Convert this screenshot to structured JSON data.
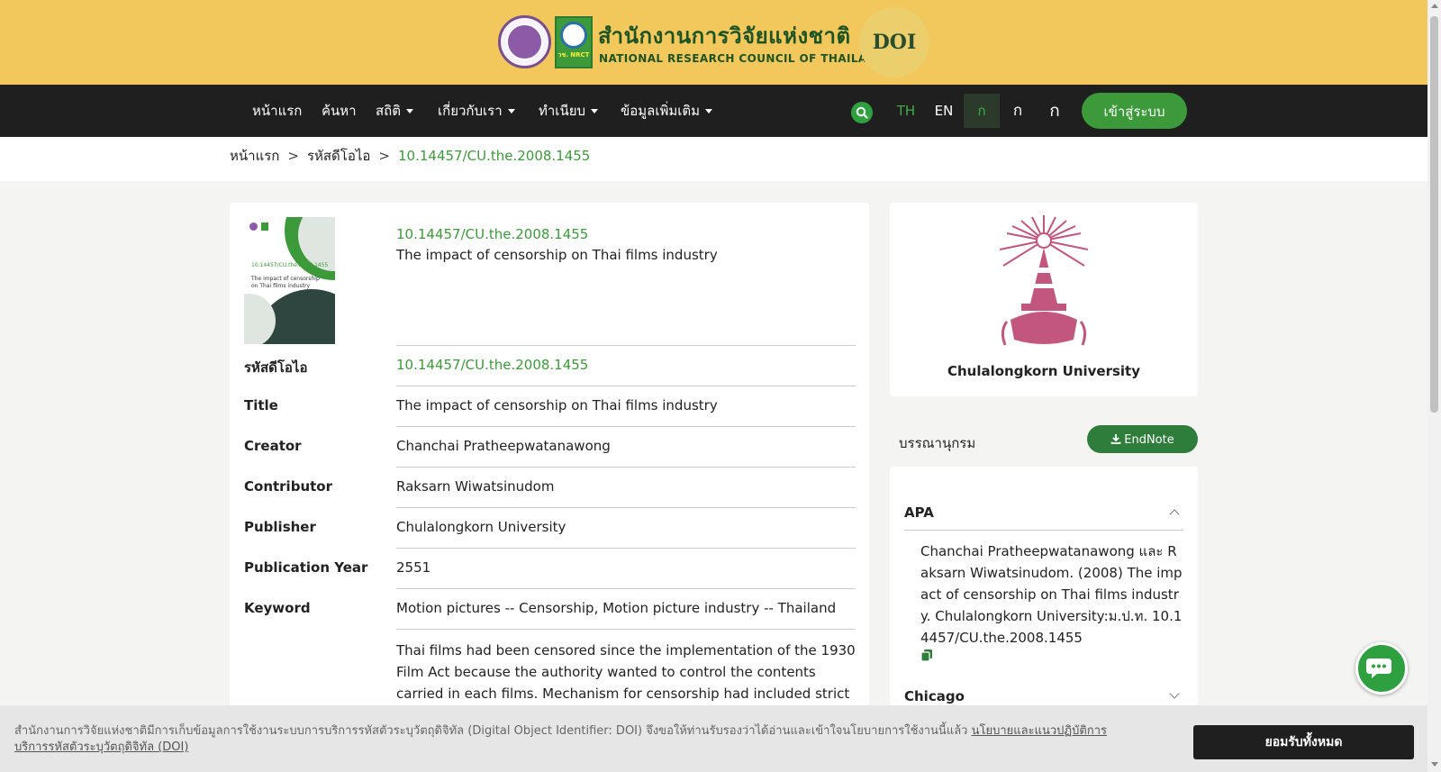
{
  "header": {
    "org_name_th": "สำนักงานการวิจัยแห่งชาติ",
    "org_name_en": "NATIONAL RESEARCH COUNCIL OF THAILAND",
    "nrct_logo_text": "วช. NRCT",
    "doi_logo_text": "DOI"
  },
  "nav": {
    "items": [
      {
        "label": "หน้าแรก"
      },
      {
        "label": "ค้นหา"
      },
      {
        "label": "สถิติ"
      },
      {
        "label": "เกี่ยวกับเรา"
      },
      {
        "label": "ทำเนียบ"
      },
      {
        "label": "ข้อมูลเพิ่มเติม"
      }
    ],
    "lang_th": "TH",
    "lang_en": "EN",
    "font_small": "ก",
    "font_medium": "ก",
    "font_large": "ก",
    "login_label": "เข้าสู่ระบบ"
  },
  "breadcrumb": {
    "home": "หน้าแรก",
    "section": "รหัสดีโอไอ",
    "current": "10.14457/CU.the.2008.1455",
    "separator": ">"
  },
  "record": {
    "cover_doi": "10.14457/CU.the.2008.1455",
    "cover_title": "The impact of censorship on Thai films industry",
    "head_doi": "10.14457/CU.the.2008.1455",
    "head_title": "The impact of censorship on Thai films industry",
    "fields": [
      {
        "label": "รหัสดีโอไอ",
        "value": "10.14457/CU.the.2008.1455"
      },
      {
        "label": "Title",
        "value": "The impact of censorship on Thai films industry"
      },
      {
        "label": "Creator",
        "value": "Chanchai Pratheepwatanawong"
      },
      {
        "label": "Contributor",
        "value": "Raksarn Wiwatsinudom"
      },
      {
        "label": "Publisher",
        "value": "Chulalongkorn University"
      },
      {
        "label": "Publication Year",
        "value": "2551"
      },
      {
        "label": "Keyword",
        "value": "Motion pictures -- Censorship, Motion picture industry -- Thailand"
      }
    ],
    "abstract": "Thai films had been censored since the implementation of the 1930 Film Act because the authority wanted to control the contents carried in each films. Mechanism for censorship had included strict control law,"
  },
  "sidebar": {
    "university_name": "Chulalongkorn University",
    "citation_heading": "บรรณานุกรม",
    "endnote_label": "EndNote",
    "apa_title": "APA",
    "apa_text": "Chanchai Pratheepwatanawong และ Raksarn Wiwatsinudom. (2008) The impact of censorship on Thai films industry. Chulalongkorn University:ม.ป.ท. 10.14457/CU.the.2008.1455",
    "chicago_title": "Chicago"
  },
  "cookie": {
    "text": "สำนักงานการวิจัยแห่งชาติมีการเก็บข้อมูลการใช้งานระบบการบริการรหัสตัวระบุวัตถุดิจิทัล (Digital Object Identifier: DOI) จึงขอให้ท่านรับรองว่าได้อ่านและเข้าใจนโยบายการใช้งานนี้แล้ว ",
    "link": "นโยบายและแนวปฏิบัติการบริการรหัสตัวระบุวัตถุดิจิทัล (DOI)",
    "accept_label": "ยอมรับทั้งหมด"
  },
  "colors": {
    "header_bg": "#f2c75c",
    "nav_bg": "#1f1f1f",
    "accent_green": "#3c9a3a",
    "university_pink": "#c2567f"
  },
  "icons": [
    "search-icon",
    "download-icon",
    "copy-icon",
    "chevron-up-icon",
    "chevron-down-icon",
    "chat-icon"
  ]
}
